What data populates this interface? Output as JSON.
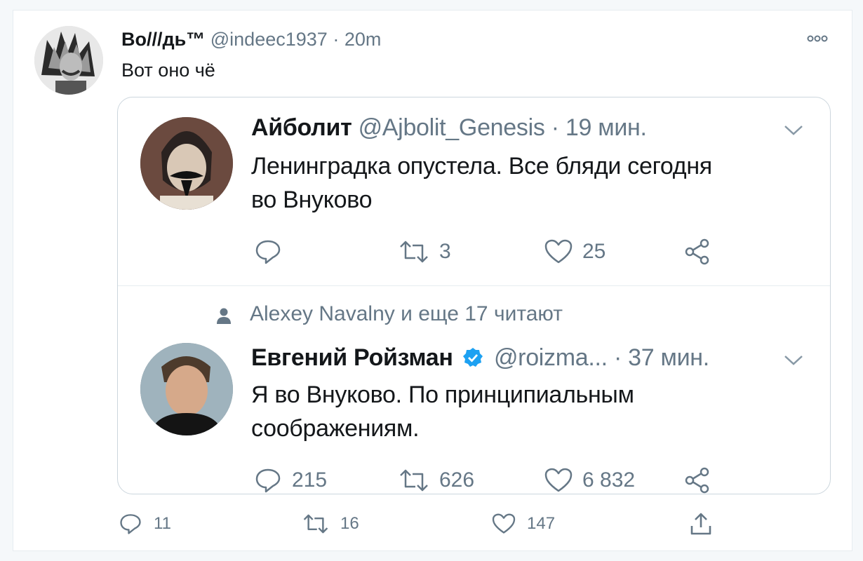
{
  "tweet": {
    "author_name": "Во///дь™",
    "author_handle": "@indeec1937",
    "time_sep": "·",
    "time": "20m",
    "text": "Вот оно чё",
    "actions": {
      "replies": "11",
      "retweets": "16",
      "likes": "147"
    }
  },
  "quote1": {
    "name": "Айболит",
    "handle": "@Ajbolit_Genesis",
    "time_sep": "·",
    "time": "19 мин.",
    "text_line1": "Ленинградка опустела. Все бляди сегодня",
    "text_line2": "во Внуково",
    "actions": {
      "replies": "",
      "retweets": "3",
      "likes": "25"
    }
  },
  "social_context": "Alexey Navalny и еще 17 читают",
  "quote2": {
    "name": "Евгений Ройзман",
    "handle": "@roizma...",
    "time_sep": "·",
    "time": "37 мин.",
    "text_line1": "Я во Внуково. По принципиальным",
    "text_line2": "соображениям.",
    "actions": {
      "replies": "215",
      "retweets": "626",
      "likes": "6 832"
    }
  },
  "colors": {
    "muted": "#657786",
    "text": "#14171a",
    "verified": "#1da1f2",
    "border": "#ccd6dd"
  },
  "icons": [
    "reply-icon",
    "retweet-icon",
    "like-icon",
    "share-icon",
    "upload-icon",
    "more-icon",
    "chevron-down-icon",
    "verified-badge-icon",
    "person-icon"
  ]
}
